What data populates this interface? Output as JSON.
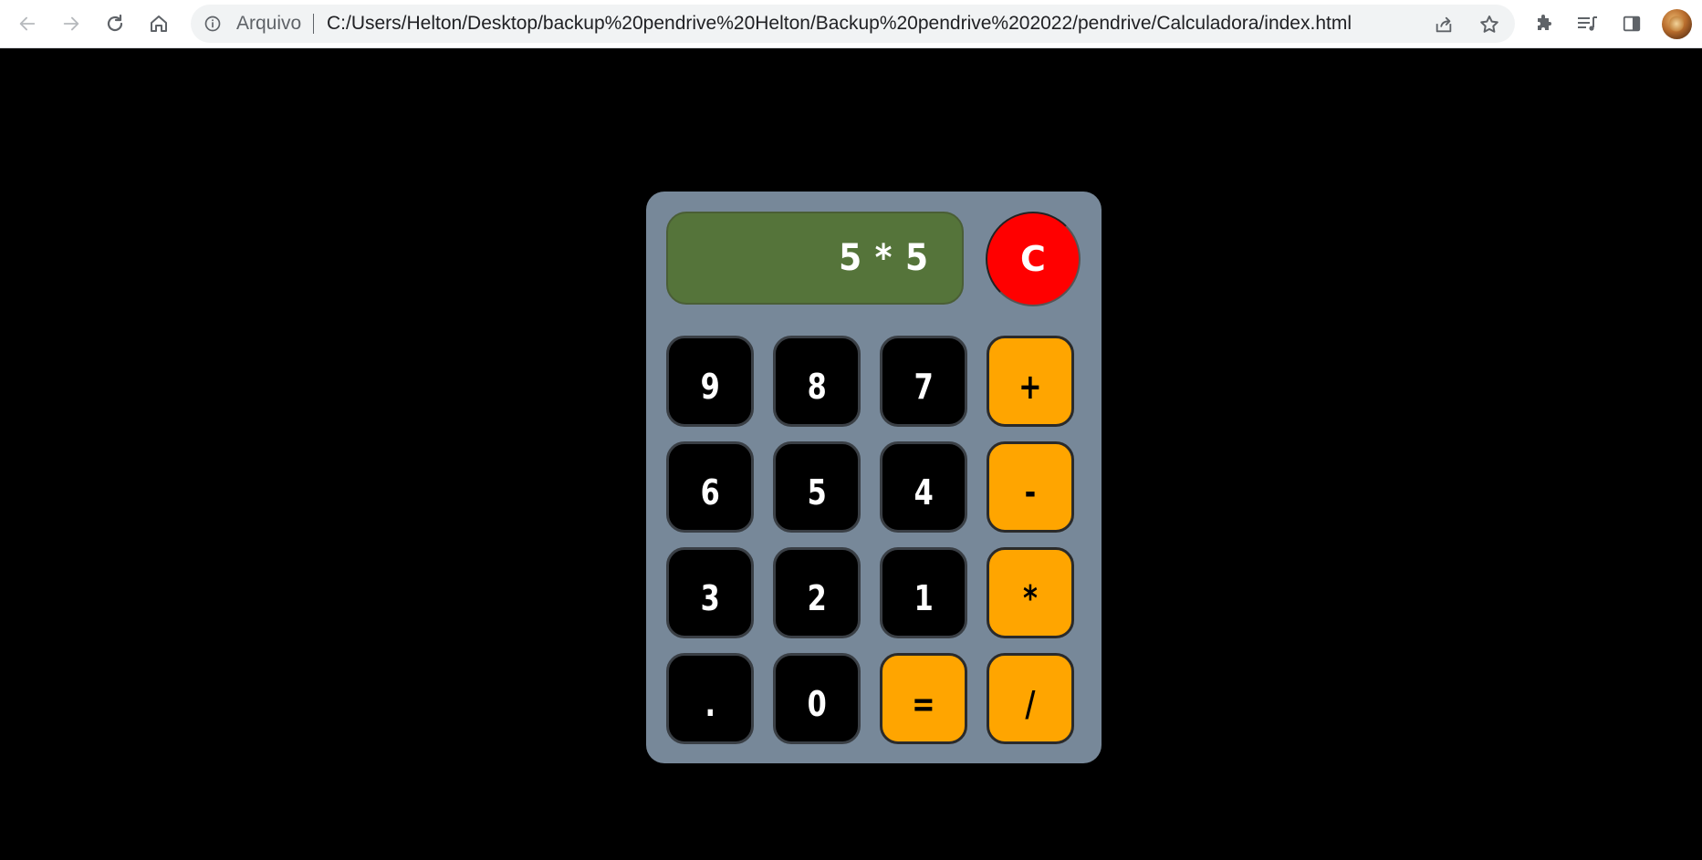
{
  "browser": {
    "security_label": "Arquivo",
    "url": "C:/Users/Helton/Desktop/backup%20pendrive%20Helton/Backup%20pendrive%202022/pendrive/Calculadora/index.html",
    "icons": [
      "back-arrow-icon",
      "forward-arrow-icon",
      "reload-icon",
      "home-icon",
      "info-icon",
      "share-icon",
      "star-icon",
      "extensions-puzzle-icon",
      "media-queue-icon",
      "side-panel-icon",
      "profile-avatar"
    ]
  },
  "calculator": {
    "display": "5 * 5",
    "clear_label": "C",
    "keys": [
      [
        "9",
        "8",
        "7",
        "+"
      ],
      [
        "6",
        "5",
        "4",
        "-"
      ],
      [
        "3",
        "2",
        "1",
        "*"
      ],
      [
        ".",
        "0",
        "=",
        "/"
      ]
    ],
    "colors": {
      "body": "#778899",
      "display": "#55743a",
      "number_key": "#000000",
      "operator_key": "#ffa500",
      "clear_key": "#ff0000"
    }
  }
}
